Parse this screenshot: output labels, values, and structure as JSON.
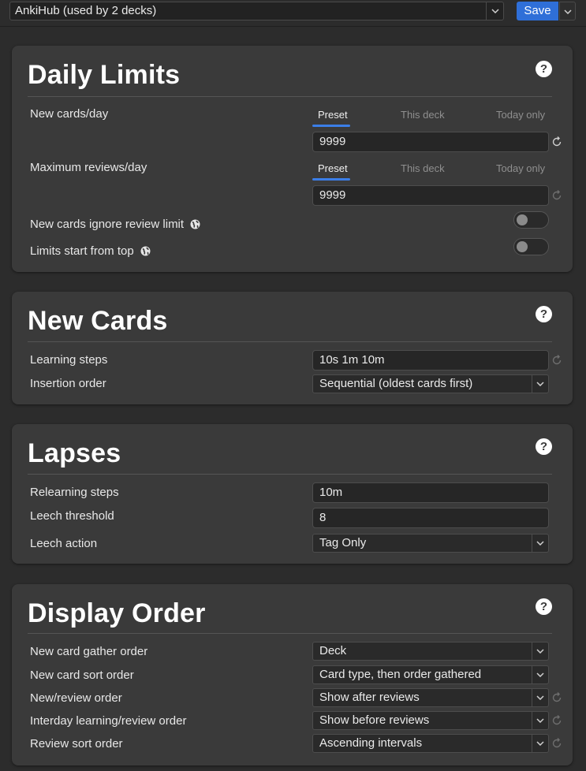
{
  "topbar": {
    "preset_label": "AnkiHub (used by 2 decks)",
    "save_label": "Save"
  },
  "daily_limits": {
    "title": "Daily Limits",
    "help": "?",
    "new_cards": {
      "label": "New cards/day",
      "tabs": [
        "Preset",
        "This deck",
        "Today only"
      ],
      "value": "9999"
    },
    "max_reviews": {
      "label": "Maximum reviews/day",
      "tabs": [
        "Preset",
        "This deck",
        "Today only"
      ],
      "value": "9999"
    },
    "ignore_review_limit": {
      "label": "New cards ignore review limit",
      "enabled": false
    },
    "limits_from_top": {
      "label": "Limits start from top",
      "enabled": false
    }
  },
  "new_cards": {
    "title": "New Cards",
    "help": "?",
    "learning_steps": {
      "label": "Learning steps",
      "value": "10s 1m 10m"
    },
    "insertion_order": {
      "label": "Insertion order",
      "value": "Sequential (oldest cards first)"
    }
  },
  "lapses": {
    "title": "Lapses",
    "help": "?",
    "relearning_steps": {
      "label": "Relearning steps",
      "value": "10m"
    },
    "leech_threshold": {
      "label": "Leech threshold",
      "value": "8"
    },
    "leech_action": {
      "label": "Leech action",
      "value": "Tag Only"
    }
  },
  "display_order": {
    "title": "Display Order",
    "help": "?",
    "gather_order": {
      "label": "New card gather order",
      "value": "Deck"
    },
    "sort_order": {
      "label": "New card sort order",
      "value": "Card type, then order gathered"
    },
    "new_review_order": {
      "label": "New/review order",
      "value": "Show after reviews"
    },
    "interday_order": {
      "label": "Interday learning/review order",
      "value": "Show before reviews"
    },
    "review_sort_order": {
      "label": "Review sort order",
      "value": "Ascending intervals"
    }
  },
  "colors": {
    "accent": "#3b7ee8",
    "save_button": "#2f6fd8",
    "card_bg": "#3a3a3a",
    "page_bg": "#2c2c2c"
  },
  "icons": {
    "help": "help-circle-icon",
    "globe": "globe-icon",
    "revert": "revert-icon",
    "chevron": "chevron-down-icon"
  }
}
